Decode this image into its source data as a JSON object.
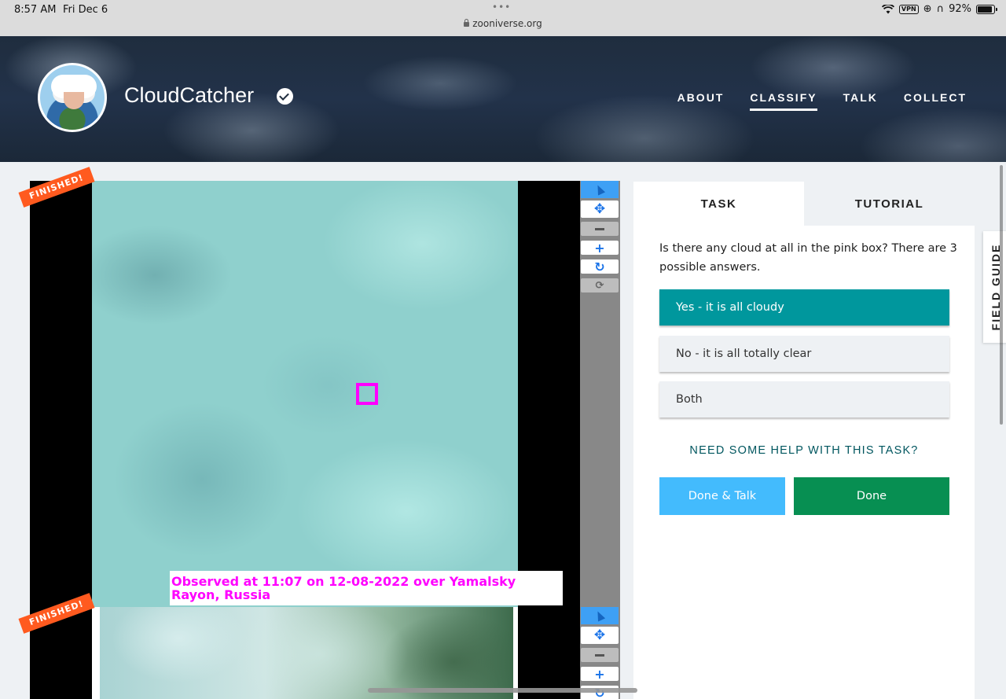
{
  "status_bar": {
    "time": "8:57 AM",
    "date": "Fri Dec 6",
    "url": "zooniverse.org",
    "vpn": "VPN",
    "battery": "92%"
  },
  "project": {
    "name": "CloudCatcher"
  },
  "nav": {
    "about": "ABOUT",
    "classify": "CLASSIFY",
    "talk": "TALK",
    "collect": "COLLECT"
  },
  "badges": {
    "finished": "FINISHED!"
  },
  "subject": {
    "caption": "Observed at 11:07 on 12-08-2022 over Yamalsky Rayon, Russia"
  },
  "task": {
    "tabs": {
      "task": "TASK",
      "tutorial": "TUTORIAL"
    },
    "question": "Is there any cloud at all in the pink box? There are 3 possible answers.",
    "answers": [
      "Yes - it is all cloudy",
      "No - it is all totally clear",
      "Both"
    ],
    "selected_answer": 0,
    "help": "NEED SOME HELP WITH THIS TASK?",
    "done_talk": "Done & Talk",
    "done": "Done"
  },
  "field_guide": {
    "label": "FIELD GUIDE"
  },
  "colors": {
    "selected_answer": "#00979d",
    "done": "#078f52",
    "done_talk": "#43bbfd",
    "finished_badge": "#ff5a1f",
    "pink_box": "#ff00ff"
  }
}
